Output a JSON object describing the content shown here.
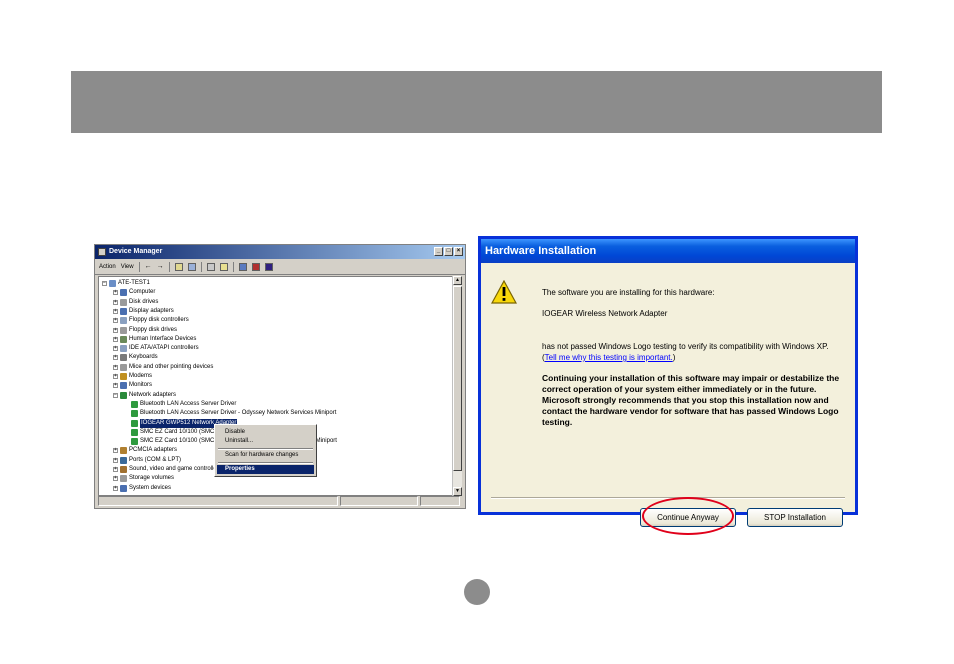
{
  "device_manager": {
    "title": "Device Manager",
    "menu": [
      "Action",
      "View"
    ],
    "tree": [
      {
        "label": "ATE-TEST1",
        "level": 0,
        "expander": "−",
        "icon": "computer-icon"
      },
      {
        "label": "Computer",
        "level": 1,
        "expander": "+",
        "icon": "monitor-icon"
      },
      {
        "label": "Disk drives",
        "level": 1,
        "expander": "+",
        "icon": "drive-icon"
      },
      {
        "label": "Display adapters",
        "level": 1,
        "expander": "+",
        "icon": "display-icon"
      },
      {
        "label": "Floppy disk controllers",
        "level": 1,
        "expander": "+",
        "icon": "controller-icon"
      },
      {
        "label": "Floppy disk drives",
        "level": 1,
        "expander": "+",
        "icon": "drive-icon"
      },
      {
        "label": "Human Interface Devices",
        "level": 1,
        "expander": "+",
        "icon": "hid-icon"
      },
      {
        "label": "IDE ATA/ATAPI controllers",
        "level": 1,
        "expander": "+",
        "icon": "controller-icon"
      },
      {
        "label": "Keyboards",
        "level": 1,
        "expander": "+",
        "icon": "keyboard-icon"
      },
      {
        "label": "Mice and other pointing devices",
        "level": 1,
        "expander": "+",
        "icon": "mouse-icon"
      },
      {
        "label": "Modems",
        "level": 1,
        "expander": "+",
        "icon": "modem-icon"
      },
      {
        "label": "Monitors",
        "level": 1,
        "expander": "+",
        "icon": "monitor-icon"
      },
      {
        "label": "Network adapters",
        "level": 1,
        "expander": "−",
        "icon": "network-icon"
      },
      {
        "label": "Bluetooth LAN Access Server Driver",
        "level": 2,
        "icon": "network-card-icon"
      },
      {
        "label": "Bluetooth LAN Access Server Driver - Odyssey Network Services Miniport",
        "level": 2,
        "icon": "network-card-icon"
      },
      {
        "label": "IOGEAR GWP512 Network Adapter",
        "level": 2,
        "icon": "network-card-icon",
        "selected": true
      },
      {
        "label": "SMC EZ Card 10/100 (SMC1211TX)",
        "level": 2,
        "icon": "network-card-icon"
      },
      {
        "label": "SMC EZ Card 10/100 (SMC1211TX) - Odyssey Network Services Miniport",
        "level": 2,
        "icon": "network-card-icon"
      },
      {
        "label": "PCMCIA adapters",
        "level": 1,
        "expander": "+",
        "icon": "pcmcia-icon"
      },
      {
        "label": "Ports (COM & LPT)",
        "level": 1,
        "expander": "+",
        "icon": "port-icon"
      },
      {
        "label": "Sound, video and game controllers",
        "level": 1,
        "expander": "+",
        "icon": "sound-icon"
      },
      {
        "label": "Storage volumes",
        "level": 1,
        "expander": "+",
        "icon": "drive-icon"
      },
      {
        "label": "System devices",
        "level": 1,
        "expander": "+",
        "icon": "system-icon"
      }
    ],
    "context_menu": {
      "disable": "Disable",
      "uninstall": "Uninstall...",
      "scan": "Scan for hardware changes",
      "properties": "Properties"
    }
  },
  "hardware_dialog": {
    "title": "Hardware Installation",
    "line1": "The software you are installing for this hardware:",
    "device_name": "IOGEAR Wireless Network Adapter",
    "not_passed_prefix": "has not passed Windows Logo testing to verify its compatibility with Windows XP. (",
    "link": "Tell me why this testing is important.",
    "not_passed_suffix": ")",
    "warning": "Continuing your installation of this software may impair or destabilize the correct operation of your system either immediately or in the future. Microsoft strongly recommends that you stop this installation now and contact the hardware vendor for software that has passed Windows Logo testing.",
    "continue_button": "Continue Anyway",
    "stop_button": "STOP Installation"
  },
  "colors": {
    "banner": "#8c8c8c",
    "xp_titlebar": "#0047d6",
    "highlight_ring": "#e0001a",
    "selection": "#0a246a"
  }
}
